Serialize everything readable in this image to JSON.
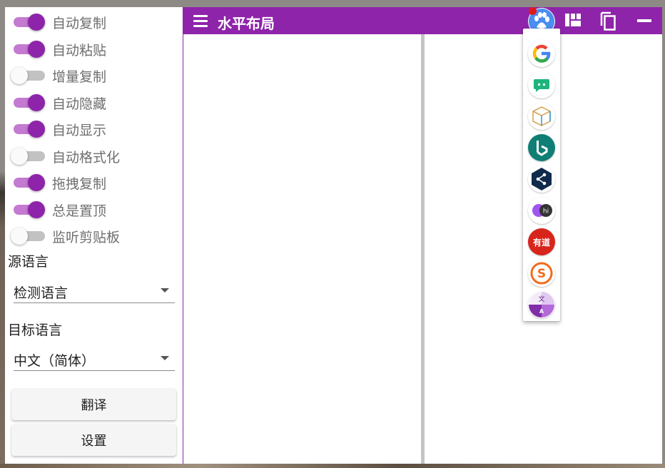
{
  "sidebar": {
    "toggles": [
      {
        "label": "自动复制",
        "on": true
      },
      {
        "label": "自动粘贴",
        "on": true
      },
      {
        "label": "增量复制",
        "on": false
      },
      {
        "label": "自动隐藏",
        "on": true
      },
      {
        "label": "自动显示",
        "on": true
      },
      {
        "label": "自动格式化",
        "on": false
      },
      {
        "label": "拖拽复制",
        "on": true
      },
      {
        "label": "总是置顶",
        "on": true
      },
      {
        "label": "监听剪贴板",
        "on": false
      }
    ],
    "source_language": {
      "label": "源语言",
      "value": "检测语言"
    },
    "target_language": {
      "label": "目标语言",
      "value": "中文（简体）"
    },
    "translate_button": "翻译",
    "settings_button": "设置"
  },
  "header": {
    "title": "水平布局",
    "icons": [
      "menu-icon",
      "baidu-paw-icon",
      "layout-icon",
      "copy-icon",
      "minimize-icon"
    ]
  },
  "engine_menu": {
    "items": [
      {
        "name": "google-icon",
        "badge": "G"
      },
      {
        "name": "chat-bubble-icon"
      },
      {
        "name": "cube-icon"
      },
      {
        "name": "bing-icon",
        "badge": "b"
      },
      {
        "name": "share-node-icon"
      },
      {
        "name": "hi-chat-icon",
        "badge": "hi"
      },
      {
        "name": "youdao-icon",
        "badge": "有道"
      },
      {
        "name": "sogou-icon",
        "badge": "S"
      },
      {
        "name": "translate-text-icon",
        "badge": "文"
      }
    ]
  },
  "colors": {
    "primary": "#8e24aa",
    "switch_track_on": "#c37ad0",
    "pane_divider": "#c4c4c4",
    "notification_dot": "#e01818"
  }
}
